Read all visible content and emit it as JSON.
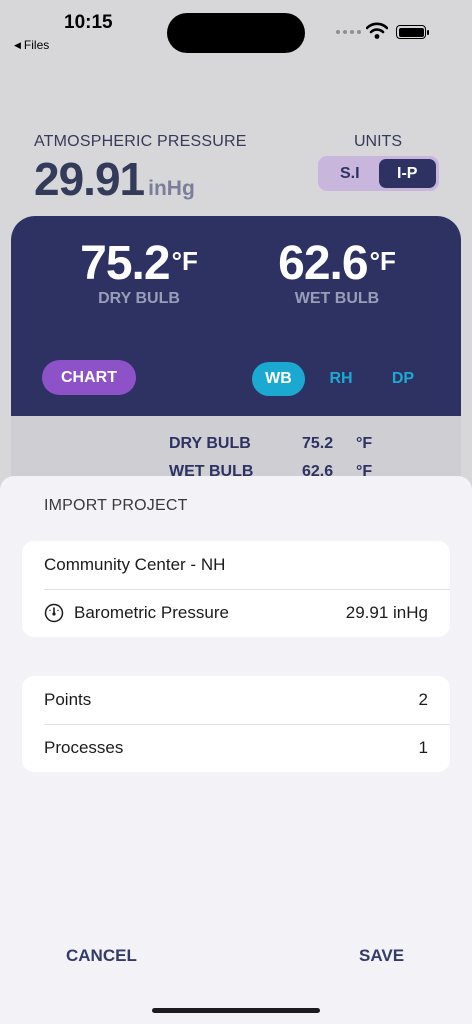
{
  "status_bar": {
    "time": "10:15",
    "back_label": "Files"
  },
  "header": {
    "atm_label": "ATMOSPHERIC PRESSURE",
    "atm_value": "29.91",
    "atm_unit": "inHg",
    "units_label": "UNITS",
    "units_options": [
      "S.I",
      "I-P"
    ],
    "units_selected": "I-P"
  },
  "readings": {
    "dry_bulb": {
      "value": "75.2",
      "unit": "°F",
      "label": "DRY BULB"
    },
    "wet_bulb": {
      "value": "62.6",
      "unit": "°F",
      "label": "WET BULB"
    }
  },
  "controls": {
    "chart_label": "CHART",
    "modes": [
      "WB",
      "RH",
      "DP"
    ],
    "mode_selected": "WB"
  },
  "table": [
    {
      "key": "DRY BULB",
      "value": "75.2",
      "unit": "°F"
    },
    {
      "key": "WET BULB",
      "value": "62.6",
      "unit": "°F"
    }
  ],
  "sheet": {
    "title": "IMPORT PROJECT",
    "project_name": "Community Center - NH",
    "barometric_label": "Barometric Pressure",
    "barometric_value": "29.91 inHg",
    "points_label": "Points",
    "points_value": "2",
    "processes_label": "Processes",
    "processes_value": "1",
    "cancel_label": "CANCEL",
    "save_label": "SAVE"
  },
  "colors": {
    "panel": "#2e3263",
    "chart_button": "#8e52c8",
    "mode_active": "#1ba9d1",
    "units_segment": "#c9b6dd"
  }
}
